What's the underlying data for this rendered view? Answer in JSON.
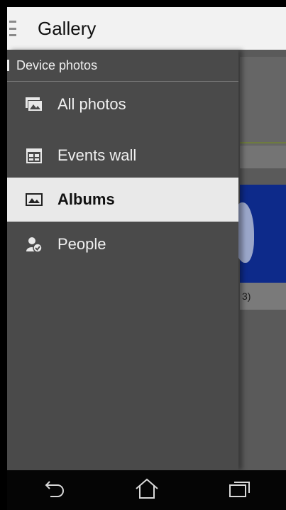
{
  "app": {
    "title": "Gallery"
  },
  "drawer": {
    "section_title": "Device photos",
    "items": [
      {
        "label": "All photos",
        "icon": "photo-icon"
      },
      {
        "label": "Events wall",
        "icon": "events-wall-icon"
      },
      {
        "label": "Albums",
        "icon": "album-icon",
        "selected": true
      },
      {
        "label": "People",
        "icon": "people-icon"
      }
    ]
  },
  "background": {
    "caption_fragment": "3)"
  },
  "navbar": {
    "buttons": [
      "back-icon",
      "home-icon",
      "recents-icon"
    ]
  }
}
